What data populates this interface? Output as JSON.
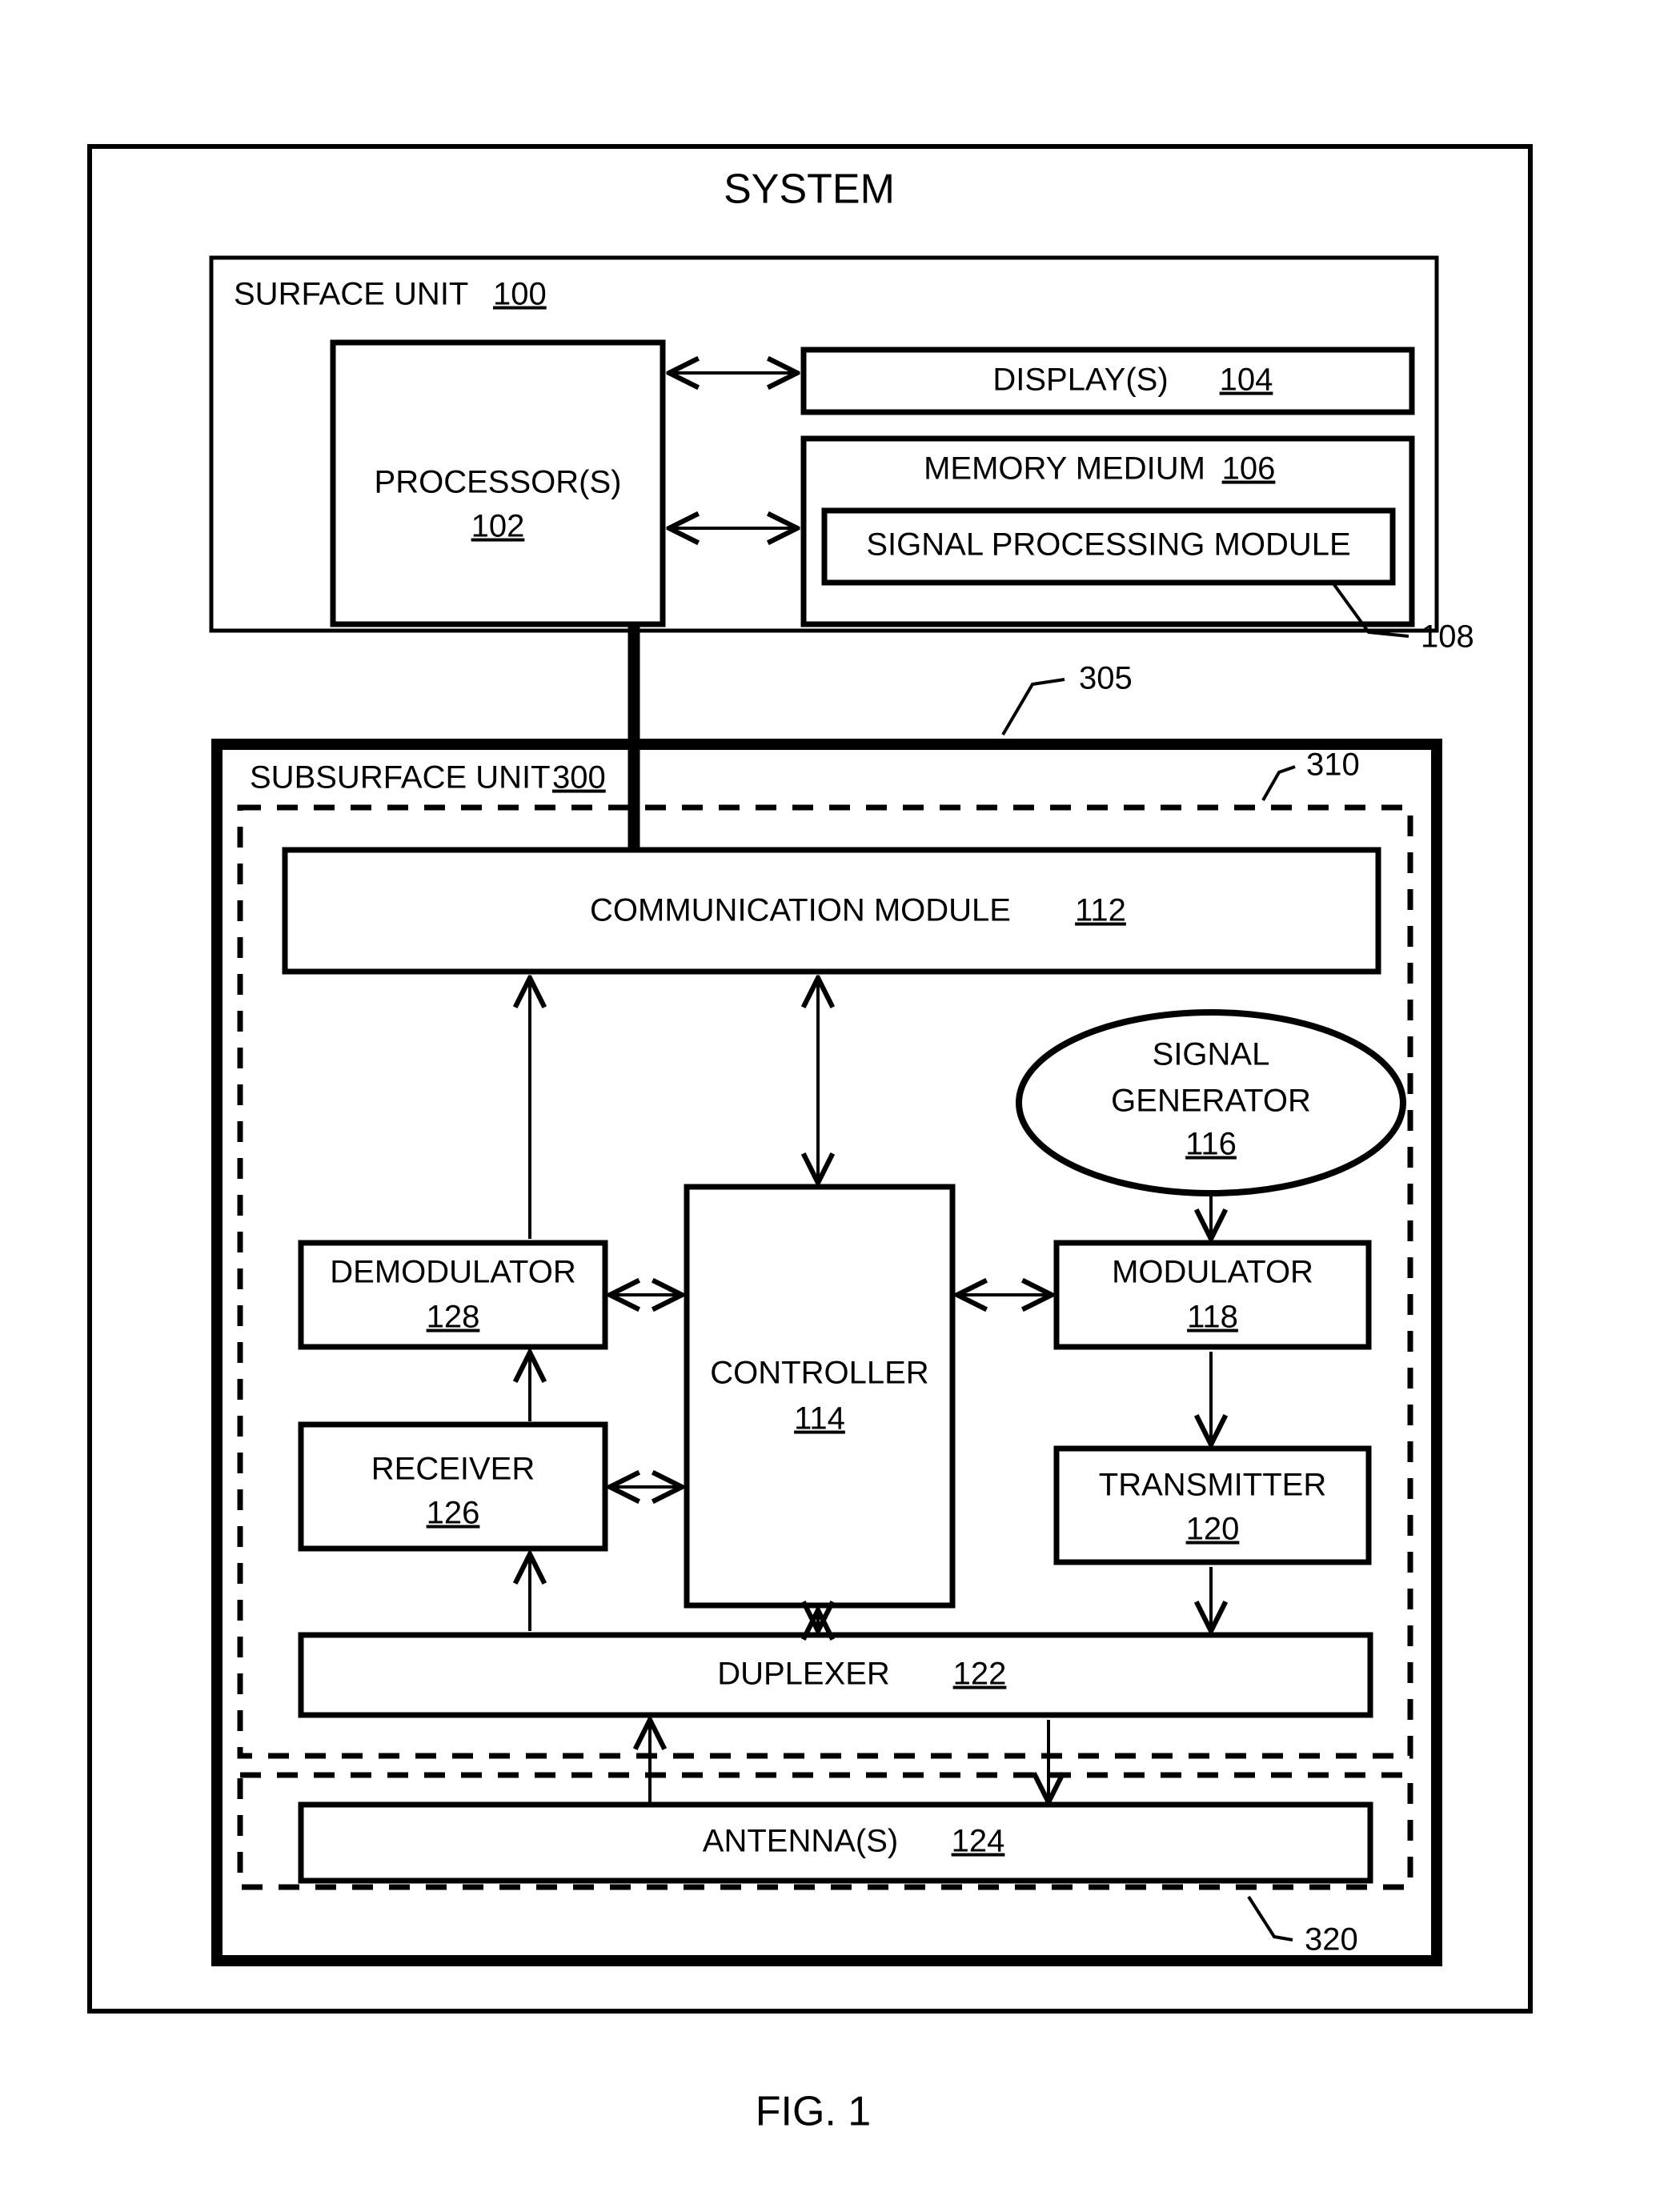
{
  "figure": {
    "title": "SYSTEM",
    "caption": "FIG. 1"
  },
  "surface_unit": {
    "label": "SURFACE UNIT",
    "ref": "100",
    "blocks": {
      "processor": {
        "label": "PROCESSOR(S)",
        "ref": "102"
      },
      "display": {
        "label": "DISPLAY(S)",
        "ref": "104"
      },
      "memory": {
        "label": "MEMORY MEDIUM",
        "ref": "106"
      },
      "signal_processing_module": {
        "label": "SIGNAL PROCESSING MODULE",
        "ref": "108"
      }
    }
  },
  "subsurface_unit": {
    "label": "SUBSURFACE UNIT",
    "ref": "300",
    "enclosure_ref": "305",
    "inner_dashed_ref": "310",
    "outer_dashed_ref": "320",
    "blocks": {
      "communication_module": {
        "label": "COMMUNICATION MODULE",
        "ref": "112"
      },
      "controller": {
        "label": "CONTROLLER",
        "ref": "114"
      },
      "signal_generator": {
        "label_line1": "SIGNAL",
        "label_line2": "GENERATOR",
        "ref": "116"
      },
      "modulator": {
        "label": "MODULATOR",
        "ref": "118"
      },
      "transmitter": {
        "label": "TRANSMITTER",
        "ref": "120"
      },
      "duplexer": {
        "label": "DUPLEXER",
        "ref": "122"
      },
      "antenna": {
        "label": "ANTENNA(S)",
        "ref": "124"
      },
      "receiver": {
        "label": "RECEIVER",
        "ref": "126"
      },
      "demodulator": {
        "label": "DEMODULATOR",
        "ref": "128"
      }
    }
  },
  "colors": {
    "stroke": "#000000",
    "background": "#ffffff"
  }
}
